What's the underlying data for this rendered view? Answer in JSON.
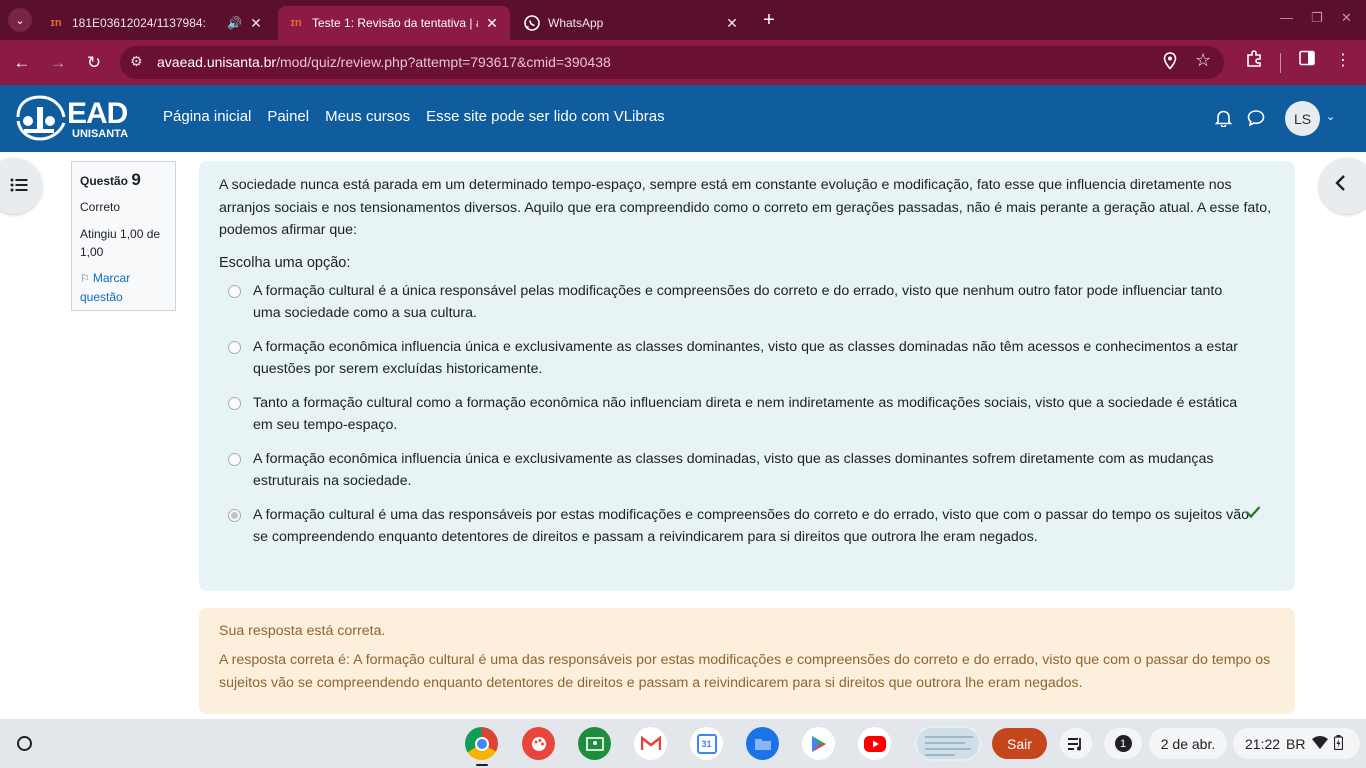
{
  "browser": {
    "tabs": [
      {
        "title": "181E03612024/1137984:",
        "favicon": "unisanta-favicon",
        "active": false,
        "has_audio": true
      },
      {
        "title": "Teste 1: Revisão da tentativa | a",
        "favicon": "unisanta-favicon",
        "active": true,
        "has_audio": false
      },
      {
        "title": "WhatsApp",
        "favicon": "whatsapp-favicon",
        "active": false,
        "has_audio": false
      }
    ],
    "url_host": "avaead.unisanta.br",
    "url_path": "/mod/quiz/review.php?attempt=793617&cmid=390438",
    "theme_color": "#8b1a45"
  },
  "site": {
    "logo_text": "EAD",
    "logo_subtext": "UNISANTA",
    "nav": [
      "Página inicial",
      "Painel",
      "Meus cursos",
      "Esse site pode ser lido com VLibras"
    ],
    "user_initials": "LS",
    "header_color": "#0f5c9e"
  },
  "question_info": {
    "label": "Questão",
    "number": "9",
    "state": "Correto",
    "grade": "Atingiu 1,00 de 1,00",
    "flag_label": "Marcar questão"
  },
  "question": {
    "text": "A sociedade nunca está parada em um determinado tempo-espaço, sempre está em constante evolução e modificação, fato esse que influencia diretamente nos arranjos sociais e nos tensionamentos diversos. Aquilo que era compreendido como o correto em gerações passadas, não é mais perante a geração atual. A esse fato, podemos afirmar que:",
    "prompt": "Escolha uma opção:",
    "options": [
      {
        "text": "A formação cultural é a única responsável pelas modificações e compreensões do correto e do errado, visto que nenhum outro fator pode influenciar tanto uma sociedade como a sua cultura.",
        "selected": false,
        "correct": false
      },
      {
        "text": "A formação econômica influencia única e exclusivamente as classes dominantes, visto que as classes dominadas não têm acessos e conhecimentos a estar questões por serem excluídas historicamente.",
        "selected": false,
        "correct": false
      },
      {
        "text": "Tanto a formação cultural como a formação econômica não influenciam direta e nem indiretamente as modificações sociais, visto que a sociedade é estática em seu tempo-espaço.",
        "selected": false,
        "correct": false
      },
      {
        "text": "A formação econômica influencia única e exclusivamente as classes dominadas, visto que as classes dominantes sofrem diretamente com as mudanças estruturais na sociedade.",
        "selected": false,
        "correct": false
      },
      {
        "text": "A formação cultural é uma das responsáveis por estas modificações e compreensões do correto e do errado, visto que com o passar do tempo os sujeitos vão se compreendendo enquanto detentores de direitos e passam a reivindicarem para si direitos que outrora lhe eram negados.",
        "selected": true,
        "correct": true
      }
    ]
  },
  "feedback": {
    "result": "Sua resposta está correta.",
    "correct_answer": "A resposta correta é: A formação cultural é uma das responsáveis por estas modificações e compreensões do correto e do errado, visto que com o passar do tempo os sujeitos vão se compreendendo enquanto detentores de direitos e passam a reivindicarem para si direitos que outrora lhe eram negados."
  },
  "shelf": {
    "apps": [
      "chrome-icon",
      "canvas-icon",
      "classroom-icon",
      "gmail-icon",
      "calendar-icon",
      "files-icon",
      "play-store-icon",
      "youtube-icon"
    ],
    "calendar_day": "31",
    "sair_label": "Sair",
    "notification_count": "1",
    "date": "2 de abr.",
    "time": "21:22",
    "input_method": "BR"
  }
}
